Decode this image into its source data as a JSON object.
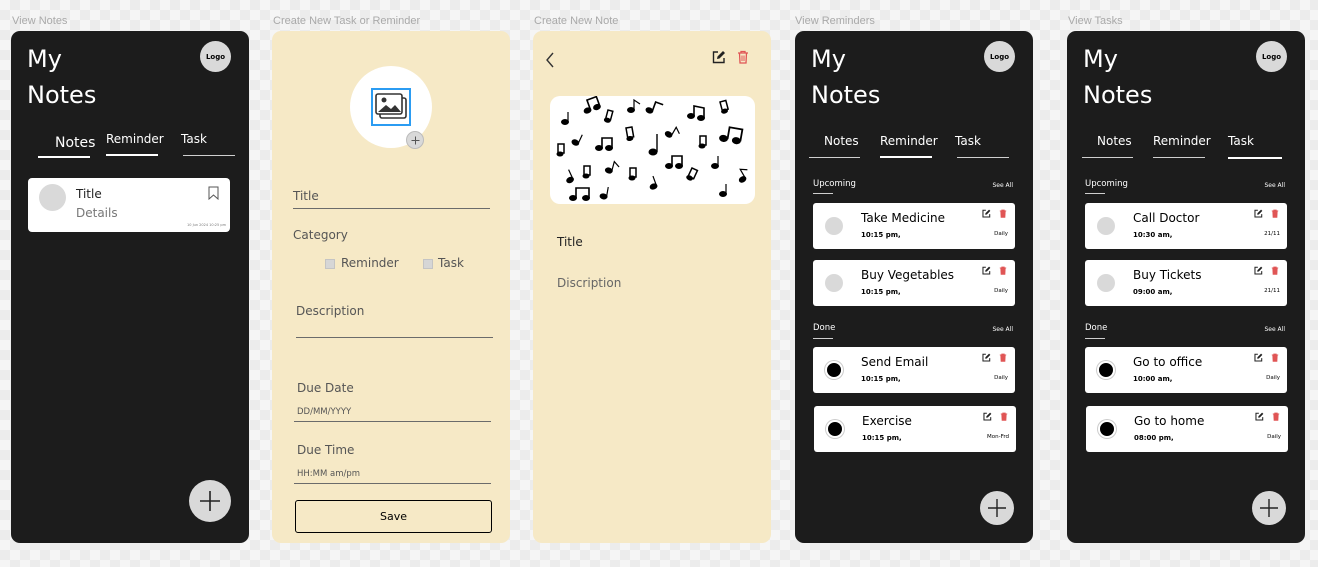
{
  "frame_labels": [
    "View Notes",
    "Create New Task or Reminder",
    "Create New Note",
    "View Reminders",
    "View Tasks"
  ],
  "app": {
    "title_line1": "My",
    "title_line2": "Notes",
    "logo": "Logo"
  },
  "tabs": [
    "Notes",
    "Reminder",
    "Task"
  ],
  "view_notes": {
    "note": {
      "title": "Title",
      "details": "Details",
      "date": "10 Jun 2024 10:25 pm"
    }
  },
  "create_task": {
    "title_label": "Title",
    "category_label": "Category",
    "options": [
      "Reminder",
      "Task"
    ],
    "description_label": "Description",
    "due_date_label": "Due Date",
    "due_date_placeholder": "DD/MM/YYYY",
    "due_time_label": "Due Time",
    "due_time_placeholder": "HH:MM  am/pm",
    "save_label": "Save"
  },
  "create_note": {
    "title_label": "Title",
    "description_label": "Discription"
  },
  "sections": {
    "upcoming": "Upcoming",
    "done": "Done",
    "see_all": "See All"
  },
  "reminders": {
    "upcoming": [
      {
        "title": "Take Medicine",
        "time": "10:15 pm,",
        "repeat": "Daily"
      },
      {
        "title": "Buy Vegetables",
        "time": "10:15 pm,",
        "repeat": "Daily"
      }
    ],
    "done": [
      {
        "title": "Send Email",
        "time": "10:15 pm,",
        "repeat": "Daily"
      },
      {
        "title": "Exercise",
        "time": "10:15 pm,",
        "repeat": "Mon-Frd"
      }
    ]
  },
  "tasks": {
    "upcoming": [
      {
        "title": "Call Doctor",
        "time": "10:30 am,",
        "repeat": "21/11"
      },
      {
        "title": "Buy Tickets",
        "time": "09:00 am,",
        "repeat": "21/11"
      }
    ],
    "done": [
      {
        "title": "Go to office",
        "time": "10:00 am,",
        "repeat": "Daily"
      },
      {
        "title": "Go to home",
        "time": "08:00 pm,",
        "repeat": "Daily"
      }
    ]
  },
  "colors": {
    "dark": "#1c1c1c",
    "cream": "#f6e9c6",
    "delete": "#e05555",
    "fab": "#d9d9d9"
  }
}
